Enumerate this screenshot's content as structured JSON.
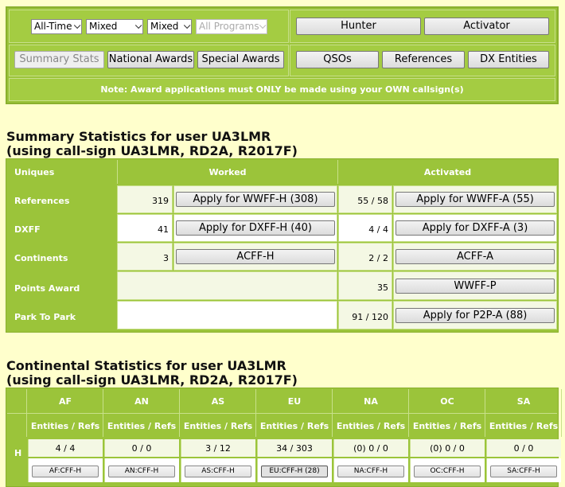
{
  "filters": {
    "time": "All-Time",
    "mode1": "Mixed",
    "mode2": "Mixed",
    "programs": "All Programs"
  },
  "role_buttons": {
    "hunter": "Hunter",
    "activator": "Activator"
  },
  "tabs": {
    "summary": "Summary Stats",
    "national": "National Awards",
    "special": "Special Awards"
  },
  "view_buttons": {
    "qsos": "QSOs",
    "references": "References",
    "dx": "DX Entities"
  },
  "note": "Note: Award applications must ONLY be made using your OWN callsign(s)",
  "summary": {
    "title_line1": "Summary Statistics for user UA3LMR",
    "title_line2": "(using call-sign UA3LMR, RD2A, R2017F)",
    "col_uniques": "Uniques",
    "col_worked": "Worked",
    "col_activated": "Activated",
    "rows": [
      {
        "label": "References",
        "worked": "319",
        "worked_btn": "Apply for WWFF-H (308)",
        "activated": "55 / 58",
        "activated_btn": "Apply for WWFF-A (55)"
      },
      {
        "label": "DXFF",
        "worked": "41",
        "worked_btn": "Apply for DXFF-H (40)",
        "activated": "4 / 4",
        "activated_btn": "Apply for DXFF-A (3)"
      },
      {
        "label": "Continents",
        "worked": "3",
        "worked_btn": "ACFF-H",
        "activated": "2 / 2",
        "activated_btn": "ACFF-A"
      },
      {
        "label": "Points Award",
        "activated": "35",
        "activated_btn": "WWFF-P"
      },
      {
        "label": "Park To Park",
        "activated": "91 / 120",
        "activated_btn": "Apply for P2P-A (88)"
      }
    ]
  },
  "continental": {
    "title_line1": "Continental Statistics for user UA3LMR",
    "title_line2": "(using call-sign UA3LMR, RD2A, R2017F)",
    "sub_header": "Entities / Refs",
    "row_label": "H",
    "columns": [
      {
        "name": "AF",
        "value": "4 / 4",
        "btn": "AF:CFF-H"
      },
      {
        "name": "AN",
        "value": "0 / 0",
        "btn": "AN:CFF-H"
      },
      {
        "name": "AS",
        "value": "3 / 12",
        "btn": "AS:CFF-H"
      },
      {
        "name": "EU",
        "value": "34 / 303",
        "btn": "EU:CFF-H (28)"
      },
      {
        "name": "NA",
        "value": "(0) 0 / 0",
        "btn": "NA:CFF-H"
      },
      {
        "name": "OC",
        "value": "(0) 0 / 0",
        "btn": "OC:CFF-H"
      },
      {
        "name": "SA",
        "value": "0 / 0",
        "btn": "SA:CFF-H"
      }
    ]
  }
}
